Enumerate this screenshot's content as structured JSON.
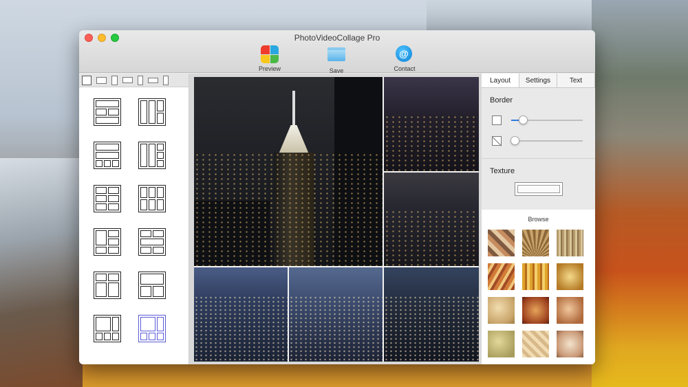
{
  "window": {
    "title": "PhotoVideoCollage Pro"
  },
  "toolbar": {
    "preview_label": "Preview",
    "save_label": "Save",
    "contact_label": "Contact",
    "contact_glyph": "@"
  },
  "left_panel": {
    "ratios": [
      "square",
      "landscape-wide",
      "portrait-tall",
      "landscape-4-3",
      "portrait-slim",
      "landscape-16-9",
      "portrait-3-4"
    ],
    "selected_ratio": 0,
    "layouts_count": 12,
    "selected_layout": 11
  },
  "right_panel": {
    "tabs": [
      {
        "label": "Layout",
        "active": true
      },
      {
        "label": "Settings",
        "active": false
      },
      {
        "label": "Text",
        "active": false
      }
    ],
    "border_title": "Border",
    "border_width_value": 0.15,
    "corner_radius_value": 0.0,
    "texture_title": "Texture",
    "browse_title": "Browse",
    "texture_count": 12
  },
  "colors": {
    "accent_blue": "#2f7ce0",
    "selected_layout": "#5a5ad8"
  }
}
